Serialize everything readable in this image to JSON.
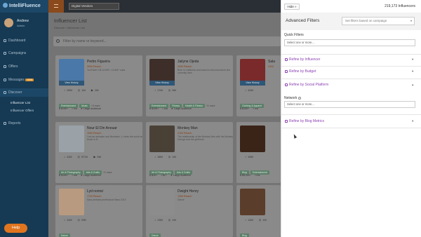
{
  "app": {
    "brand": "IntelliFluence",
    "help_label": "Help",
    "top_select": "Digital Vendors"
  },
  "user": {
    "name": "Andrew",
    "role": "Admin"
  },
  "sidebar": {
    "items": [
      {
        "label": "Dashboard",
        "icon": "dashboard-icon"
      },
      {
        "label": "Campaigns",
        "icon": "campaign-icon"
      },
      {
        "label": "Offers",
        "icon": "offers-icon"
      },
      {
        "label": "Messages",
        "badge": "NEW",
        "icon": "message-icon"
      },
      {
        "label": "Discover",
        "icon": "discover-icon"
      },
      {
        "label": "Reports",
        "icon": "report-icon"
      }
    ],
    "sub_items": [
      {
        "label": "Influencer List"
      },
      {
        "label": "Influencer Offers"
      }
    ]
  },
  "main": {
    "title": "Influencer List",
    "breadcrumb": "Discover / Influencer List",
    "search_placeholder": "Filter by name or keyword..."
  },
  "cards": [
    {
      "name": "Pedro Figueira",
      "reach": "35M Reach",
      "desc": "YouTuber! Hit 14.6M+, 14.6M+ subs",
      "soc": [
        "15M",
        "1M",
        "1M"
      ],
      "tags": [
        "Entertainment",
        "Music"
      ],
      "more": "+3 more",
      "price": "$10K+",
      "type": "n/a",
      "aud": "Large Audience",
      "view": "View History",
      "img": "#4a78a8"
    },
    {
      "name": "Jailyne Ojeda",
      "reach": "28M Reach",
      "desc": "Born in California and raised in Arizona where she currently lives",
      "soc": [
        "17M",
        "9M"
      ],
      "tags": [
        "Entertainment",
        "Fitness",
        "Health & Fitness"
      ],
      "more": "+1 more",
      "price": "$10K+",
      "type": "n/a",
      "aud": "Large Audience",
      "view": "View History",
      "img": "#3e2e2a"
    },
    {
      "name": "Sala",
      "reach": "24M",
      "desc": "",
      "soc": [
        "10M"
      ],
      "tags": [
        "Clothing & Apparel"
      ],
      "more": "",
      "price": "$10K+",
      "type": "n/a",
      "aud": "",
      "view": "View History",
      "img": "#7a2a2a"
    },
    {
      "name": "Nour El Din Anouar",
      "reach": "19M Reach",
      "desc": "I am an animator and illustrator :) I draw the world and those in it!",
      "soc": [
        "11M",
        "571K",
        "5M"
      ],
      "tags": [
        "Art & Photography",
        "Arts & Crafts"
      ],
      "more": "+1 more",
      "price": "$10K+",
      "type": "n/a",
      "aud": "Large Audience",
      "view": "",
      "img": "#9aa2a8"
    },
    {
      "name": "Monkey Man",
      "reach": "20M Reach",
      "desc": "The relationship of the Monkey Man with his Monkey George and the girlfriend",
      "soc": [
        "18M",
        "1M"
      ],
      "tags": [
        "Art & Photography",
        "Arts & Crafts"
      ],
      "more": "",
      "price": "$1K+",
      "type": "$1+",
      "aud": "Large Audience",
      "view": "",
      "img": "#4a4136"
    },
    {
      "name": "",
      "reach": "",
      "desc": "",
      "soc": [
        "15M"
      ],
      "tags": [
        "Blog",
        "Entertainment"
      ],
      "more": "",
      "price": "$5,000+",
      "type": "n/a",
      "aud": "",
      "view": "",
      "img": "#3a2418"
    },
    {
      "name": "Lyd nomst",
      "reach": "17M Reach",
      "desc": "Sara pedraza profesional Mass 2013",
      "soc": [
        "11M",
        "29K"
      ],
      "tags": [
        "Dance"
      ],
      "more": "",
      "price": "",
      "type": "",
      "aud": "",
      "view": "",
      "img": "#b89a80"
    },
    {
      "name": "Dwight Henry",
      "reach": "13M Reach",
      "desc": "Dance",
      "soc": [
        "13M",
        "1M"
      ],
      "tags": [
        "Dance"
      ],
      "more": "",
      "price": "",
      "type": "",
      "aud": "",
      "view": "",
      "img": "#8c8c8c"
    },
    {
      "name": "",
      "reach": "",
      "desc": "",
      "soc": [
        "14M",
        "1M"
      ],
      "tags": [
        "Blog"
      ],
      "more": "",
      "price": "",
      "type": "",
      "aud": "",
      "view": "",
      "img": "#5a3d2a"
    }
  ],
  "panel": {
    "hide_label": "Hide »",
    "count": "219,173 Influencers",
    "title": "Advanced Filters",
    "campaign_placeholder": "Set filters based on campaign",
    "quick_filters_label": "Quick Filters",
    "quick_filters_placeholder": "Select one or more...",
    "sections": [
      {
        "label": "Refine by Influencer",
        "icon": "person-icon",
        "chevron": "▾"
      },
      {
        "label": "Refine by Budget",
        "icon": "dollar-icon",
        "chevron": "▾"
      },
      {
        "label": "Refine by Social Platform",
        "icon": "share-icon",
        "chevron": "▴"
      },
      {
        "label": "Refine by Blog Metrics",
        "icon": "pencil-icon",
        "chevron": "▾"
      }
    ],
    "network_label": "Network",
    "network_placeholder": "Select one or more..."
  }
}
